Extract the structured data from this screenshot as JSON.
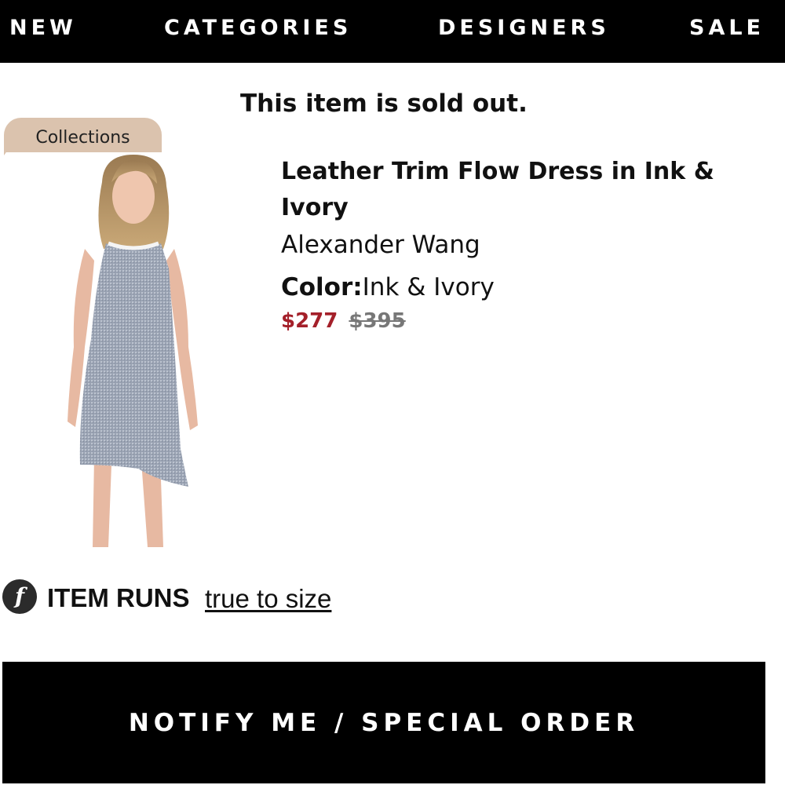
{
  "nav": {
    "items": [
      {
        "label": "NEW"
      },
      {
        "label": "CATEGORIES"
      },
      {
        "label": "DESIGNERS"
      },
      {
        "label": "SALE"
      }
    ]
  },
  "notice": "This item is sold out.",
  "collections_tag": "Collections",
  "product": {
    "name": "Leather Trim Flow Dress in Ink & Ivory",
    "designer": "Alexander Wang",
    "color_label": "Color:",
    "color_value": "Ink & Ivory",
    "sale_price": "$277",
    "original_price": "$395"
  },
  "fit": {
    "icon": "f",
    "label": "ITEM RUNS",
    "value": "true to size"
  },
  "cta": {
    "label": "NOTIFY ME / SPECIAL ORDER"
  },
  "colors": {
    "sale_price": "#a4202a",
    "tag_bg": "#dbc3ae",
    "nav_bg": "#000000"
  }
}
